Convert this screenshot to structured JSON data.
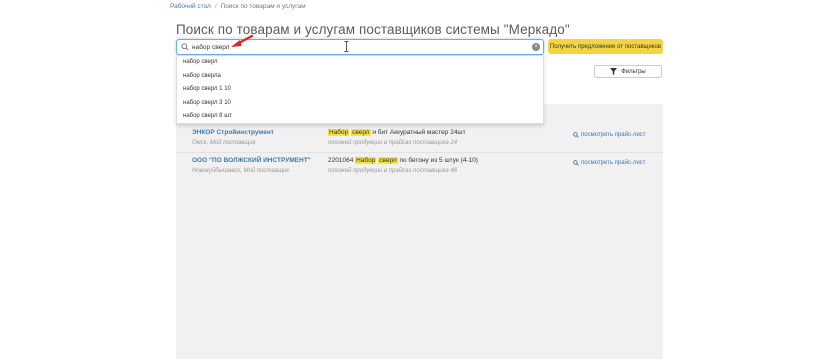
{
  "breadcrumb": {
    "home": "Рабочий стол",
    "separator": "/",
    "current": "Поиск по товарам и услугам"
  },
  "page_title": "Поиск по товарам и услугам поставщиков системы \"Меркадо\"",
  "search": {
    "value": "набор сверл",
    "clear_symbol": "×"
  },
  "primary_button": "Получить предложение от поставщиков",
  "filters_button": "Фильтры",
  "suggestions": [
    "набор сверл",
    "набор сверла",
    "набор сверл 1 10",
    "набор сверл 3 10",
    "набор сверл 8 шт"
  ],
  "results": [
    {
      "supplier": "ЭНКОР Стройинструмент",
      "meta": "Омск, Мой поставщик",
      "title_prefix": "",
      "title_hl1": "Набор",
      "title_mid": " ",
      "title_hl2": "сверл",
      "title_suffix": " и бит Аккуратный мастер 24шт",
      "sub": "похожей продукции в прайсах поставщика 24",
      "price_link": "посмотреть прайс-лист"
    },
    {
      "supplier": "ООО \"ПО ВОЛЖСКИЙ ИНСТРУМЕНТ\"",
      "meta": "Новокуйбышевск, Мой поставщик",
      "title_prefix": "2201064 ",
      "title_hl1": "Набор",
      "title_mid": " ",
      "title_hl2": "сверл",
      "title_suffix": " по бетону из 5 штук (4-10)",
      "sub": "похожей продукции в прайсах поставщика 46",
      "price_link": "посмотреть прайс-лист"
    }
  ],
  "colors": {
    "accent": "#f5d53f",
    "link": "#3a79b8",
    "highlight": "#f5e53a",
    "arrow": "#e02424"
  },
  "icons": {
    "search": "search-icon",
    "clear": "clear-icon",
    "filter": "filter-icon",
    "price": "search-icon"
  }
}
